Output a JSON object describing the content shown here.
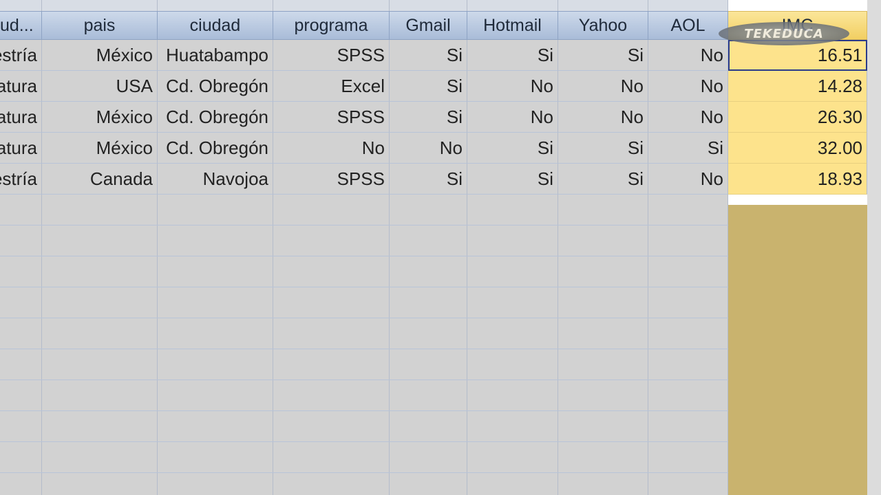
{
  "columns": [
    "ud...",
    "pais",
    "ciudad",
    "programa",
    "Gmail",
    "Hotmail",
    "Yahoo",
    "AOL",
    "IMC"
  ],
  "rows": [
    [
      "estría",
      "México",
      "Huatabampo",
      "SPSS",
      "Si",
      "Si",
      "Si",
      "No",
      "16.51"
    ],
    [
      "atura",
      "USA",
      "Cd. Obregón",
      "Excel",
      "Si",
      "No",
      "No",
      "No",
      "14.28"
    ],
    [
      "atura",
      "México",
      "Cd. Obregón",
      "SPSS",
      "Si",
      "No",
      "No",
      "No",
      "26.30"
    ],
    [
      "atura",
      "México",
      "Cd. Obregón",
      "No",
      "No",
      "Si",
      "Si",
      "Si",
      "32.00"
    ],
    [
      "estría",
      "Canada",
      "Navojoa",
      "SPSS",
      "Si",
      "Si",
      "Si",
      "No",
      "18.93"
    ]
  ],
  "watermark": "TEKEDUCA",
  "colors": {
    "header_blue": "#a9bcd8",
    "imc_highlight": "#fde38c",
    "selected_border": "#2a3a8a"
  }
}
